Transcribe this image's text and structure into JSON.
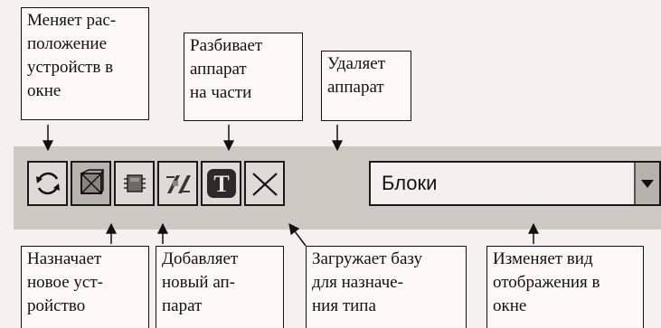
{
  "callouts_top": [
    {
      "lines": [
        "Меняет рас-",
        "положение",
        "устройств в",
        "окне"
      ]
    },
    {
      "lines": [
        "Разбивает",
        "аппарат",
        "на части"
      ]
    },
    {
      "lines": [
        "Удаляет",
        "аппарат"
      ]
    }
  ],
  "callouts_bottom": [
    {
      "lines": [
        "Назначает",
        "новое уст-",
        "ройство"
      ]
    },
    {
      "lines": [
        "Добавляет",
        "новый ап-",
        "парат"
      ]
    },
    {
      "lines": [
        "Загружает базу",
        "для назначе-",
        "ния типа"
      ]
    },
    {
      "lines": [
        "Изменяет вид",
        "отображения в",
        "окне"
      ]
    }
  ],
  "toolbar": {
    "buttons": [
      {
        "icon": "rotate-arrows-icon"
      },
      {
        "icon": "cube-icon"
      },
      {
        "icon": "add-device-icon"
      },
      {
        "icon": "split-device-icon"
      },
      {
        "icon": "type-database-icon",
        "glyph": "T"
      },
      {
        "icon": "delete-x-icon"
      }
    ],
    "view_select": {
      "value": "Блоки",
      "arrow_icon": "dropdown-arrow-icon"
    }
  }
}
